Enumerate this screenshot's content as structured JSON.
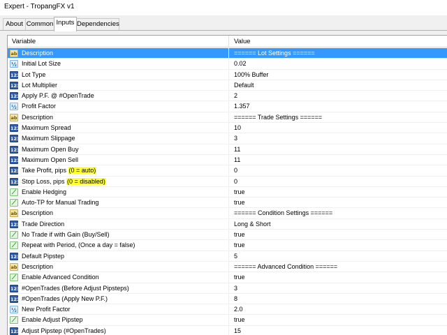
{
  "window": {
    "title": "Expert - TropangFX v1"
  },
  "tabs": [
    {
      "label": "About"
    },
    {
      "label": "Common"
    },
    {
      "label": "Inputs"
    },
    {
      "label": "Dependencies"
    }
  ],
  "active_tab": "Inputs",
  "grid": {
    "header": {
      "variable": "Variable",
      "value": "Value"
    },
    "rows": [
      {
        "icon": "ab",
        "variable": "Description",
        "value": "====== Lot Settings ======",
        "selected": true
      },
      {
        "icon": "half",
        "variable": "Initial Lot Size",
        "value": "0.02"
      },
      {
        "icon": "123",
        "variable": "Lot Type",
        "value": "100% Buffer"
      },
      {
        "icon": "123",
        "variable": "Lot Multiplier",
        "value": "Default"
      },
      {
        "icon": "123",
        "variable": "Apply P.F. @ #OpenTrade",
        "value": "2"
      },
      {
        "icon": "half",
        "variable": "Profit Factor",
        "value": "1.357"
      },
      {
        "icon": "ab",
        "variable": "Description",
        "value": "====== Trade Settings ======"
      },
      {
        "icon": "123",
        "variable": "Maximum Spread",
        "value": "10"
      },
      {
        "icon": "123",
        "variable": "Maximum Slippage",
        "value": "3"
      },
      {
        "icon": "123",
        "variable": "Maximum Open Buy",
        "value": "11"
      },
      {
        "icon": "123",
        "variable": "Maximum Open Sell",
        "value": "11"
      },
      {
        "icon": "123",
        "variable": "Take Profit, pips ",
        "variable_hl": "(0 = auto)",
        "value": "0"
      },
      {
        "icon": "123",
        "variable": "Stop Loss, pips ",
        "variable_hl": "(0 = disabled)",
        "value": "0"
      },
      {
        "icon": "bool",
        "variable": "Enable Hedging",
        "value": "true"
      },
      {
        "icon": "bool",
        "variable": "Auto-TP for Manual Trading",
        "value": "true"
      },
      {
        "icon": "ab",
        "variable": "Description",
        "value": "====== Condition Settings ======"
      },
      {
        "icon": "123",
        "variable": "Trade Direction",
        "value": "Long & Short"
      },
      {
        "icon": "bool",
        "variable": "No Trade if with Gain (Buy/Sell)",
        "value": "true"
      },
      {
        "icon": "bool",
        "variable": "Repeat with Period, (Once a day = false)",
        "value": "true"
      },
      {
        "icon": "123",
        "variable": "Default Pipstep",
        "value": "5"
      },
      {
        "icon": "ab",
        "variable": "Description",
        "value": "====== Advanced Condition ======"
      },
      {
        "icon": "bool",
        "variable": "Enable Advanced Condition",
        "value": "true"
      },
      {
        "icon": "123",
        "variable": "#OpenTrades (Before Adjust Pipsteps)",
        "value": "3"
      },
      {
        "icon": "123",
        "variable": "#OpenTrades (Apply New P.F.)",
        "value": "8"
      },
      {
        "icon": "half",
        "variable": "New Profit Factor",
        "value": "2.0"
      },
      {
        "icon": "bool",
        "variable": "Enable Adjust Pipstep",
        "value": "true"
      },
      {
        "icon": "123",
        "variable": "Adjust Pipstep (#OpenTrades)",
        "value": "15"
      }
    ]
  },
  "icons": {
    "ab": {
      "name": "string-icon",
      "glyph": "ab"
    },
    "123": {
      "name": "integer-icon",
      "glyph": "123"
    },
    "half": {
      "name": "double-icon",
      "glyph": "½"
    },
    "bool": {
      "name": "boolean-icon",
      "glyph": "⟋"
    }
  },
  "colors": {
    "selection": "#3399ff",
    "highlight": "#ffff33"
  }
}
